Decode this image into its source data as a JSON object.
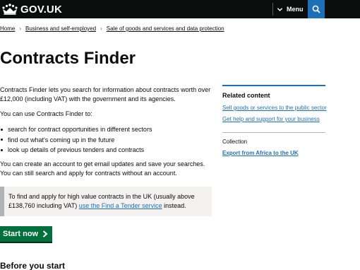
{
  "header": {
    "logo_text": "GOV.UK",
    "menu_label": "Menu"
  },
  "breadcrumbs": [
    "Home",
    "Business and self-employed",
    "Sale of goods and services and data protection"
  ],
  "page_title": "Contracts Finder",
  "intro": {
    "p1": "Contracts Finder lets you search for information about contracts worth over £12,000 (including VAT) with the government and its agencies.",
    "p2": "You can use Contracts Finder to:",
    "bullets": [
      "search for contract opportunities in different sectors",
      "find out what's coming up in the future",
      "look up details of previous tenders and contracts"
    ],
    "p3": "You can create an account to get email updates and save your searches. You can still search and apply for contracts without an account."
  },
  "inset": {
    "text_before": "To find and apply for high value contracts in the UK (usually above £138,760 including VAT) ",
    "link_text": "use the Find a Tender service",
    "text_after": " instead."
  },
  "start_button_label": "Start now",
  "before_you_start_heading": "Before you start",
  "related": {
    "title": "Related content",
    "links": [
      "Sell goods or services to the public sector",
      "Get help and support for your business"
    ],
    "collection_label": "Collection",
    "collection_link": "Export from Africa to the UK"
  },
  "colors": {
    "header_bg": "#0b0c0c",
    "link": "#1d70b8",
    "start_button": "#00703c",
    "inset_bg": "#f3f2f1"
  }
}
